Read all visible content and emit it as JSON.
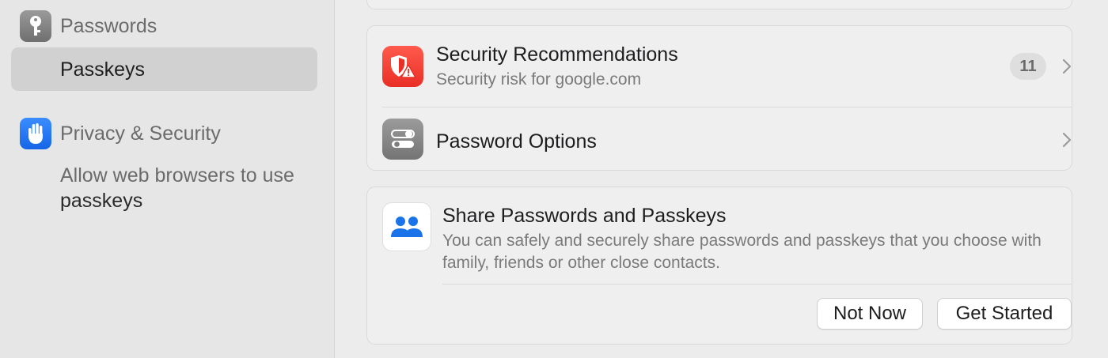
{
  "sidebar": {
    "passwords_label": "Passwords",
    "passkeys_label": "Passkeys",
    "privacy_label": "Privacy & Security",
    "privacy_desc_prefix": "Allow web browsers to use ",
    "privacy_desc_highlight": "passkeys"
  },
  "security": {
    "title": "Security Recommendations",
    "subtitle": "Security risk for google.com",
    "badge": "11"
  },
  "options": {
    "title": "Password Options"
  },
  "share": {
    "title": "Share Passwords and Passkeys",
    "description": "You can safely and securely share passwords and passkeys that you choose with family, friends or other close contacts.",
    "not_now_label": "Not Now",
    "get_started_label": "Get Started"
  },
  "colors": {
    "security_red": "#e92f25",
    "accent_blue": "#1a73e8",
    "sidebar_selection": "#d1d1d1"
  },
  "icons": {
    "passwords": "key-icon",
    "privacy": "hand-icon",
    "security": "shield-warning-icon",
    "options": "toggles-icon",
    "share": "people-icon"
  }
}
